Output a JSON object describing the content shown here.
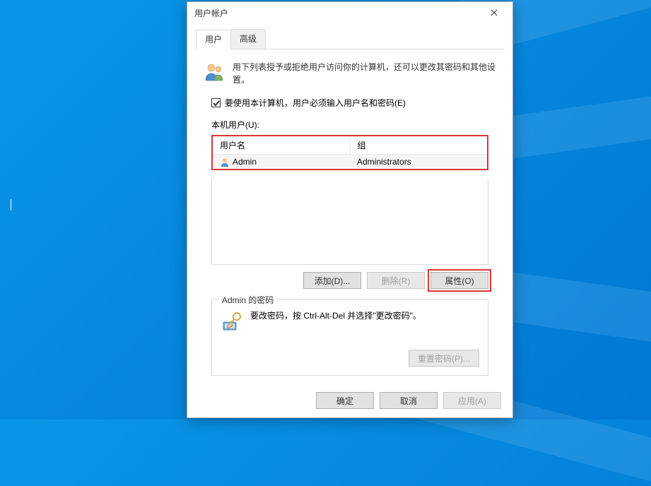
{
  "window": {
    "title": "用户帐户"
  },
  "tabs": {
    "user": "用户",
    "advanced": "高级"
  },
  "intro": "用下列表授予或拒绝用户访问你的计算机，还可以更改其密码和其他设置。",
  "checkbox_label": "要使用本计算机，用户必须输入用户名和密码(E)",
  "users_label": "本机用户(U):",
  "table": {
    "col_username": "用户名",
    "col_group": "组",
    "rows": [
      {
        "username": "Admin",
        "group": "Administrators"
      }
    ]
  },
  "buttons": {
    "add": "添加(D)...",
    "delete": "删除(R)",
    "properties": "属性(O)",
    "ok": "确定",
    "cancel": "取消",
    "apply": "应用(A)",
    "reset_pw": "重置密码(P)..."
  },
  "password_group": {
    "title": "Admin 的密码",
    "text": "要改密码，按 Ctrl-Alt-Del 并选择\"更改密码\"。"
  }
}
